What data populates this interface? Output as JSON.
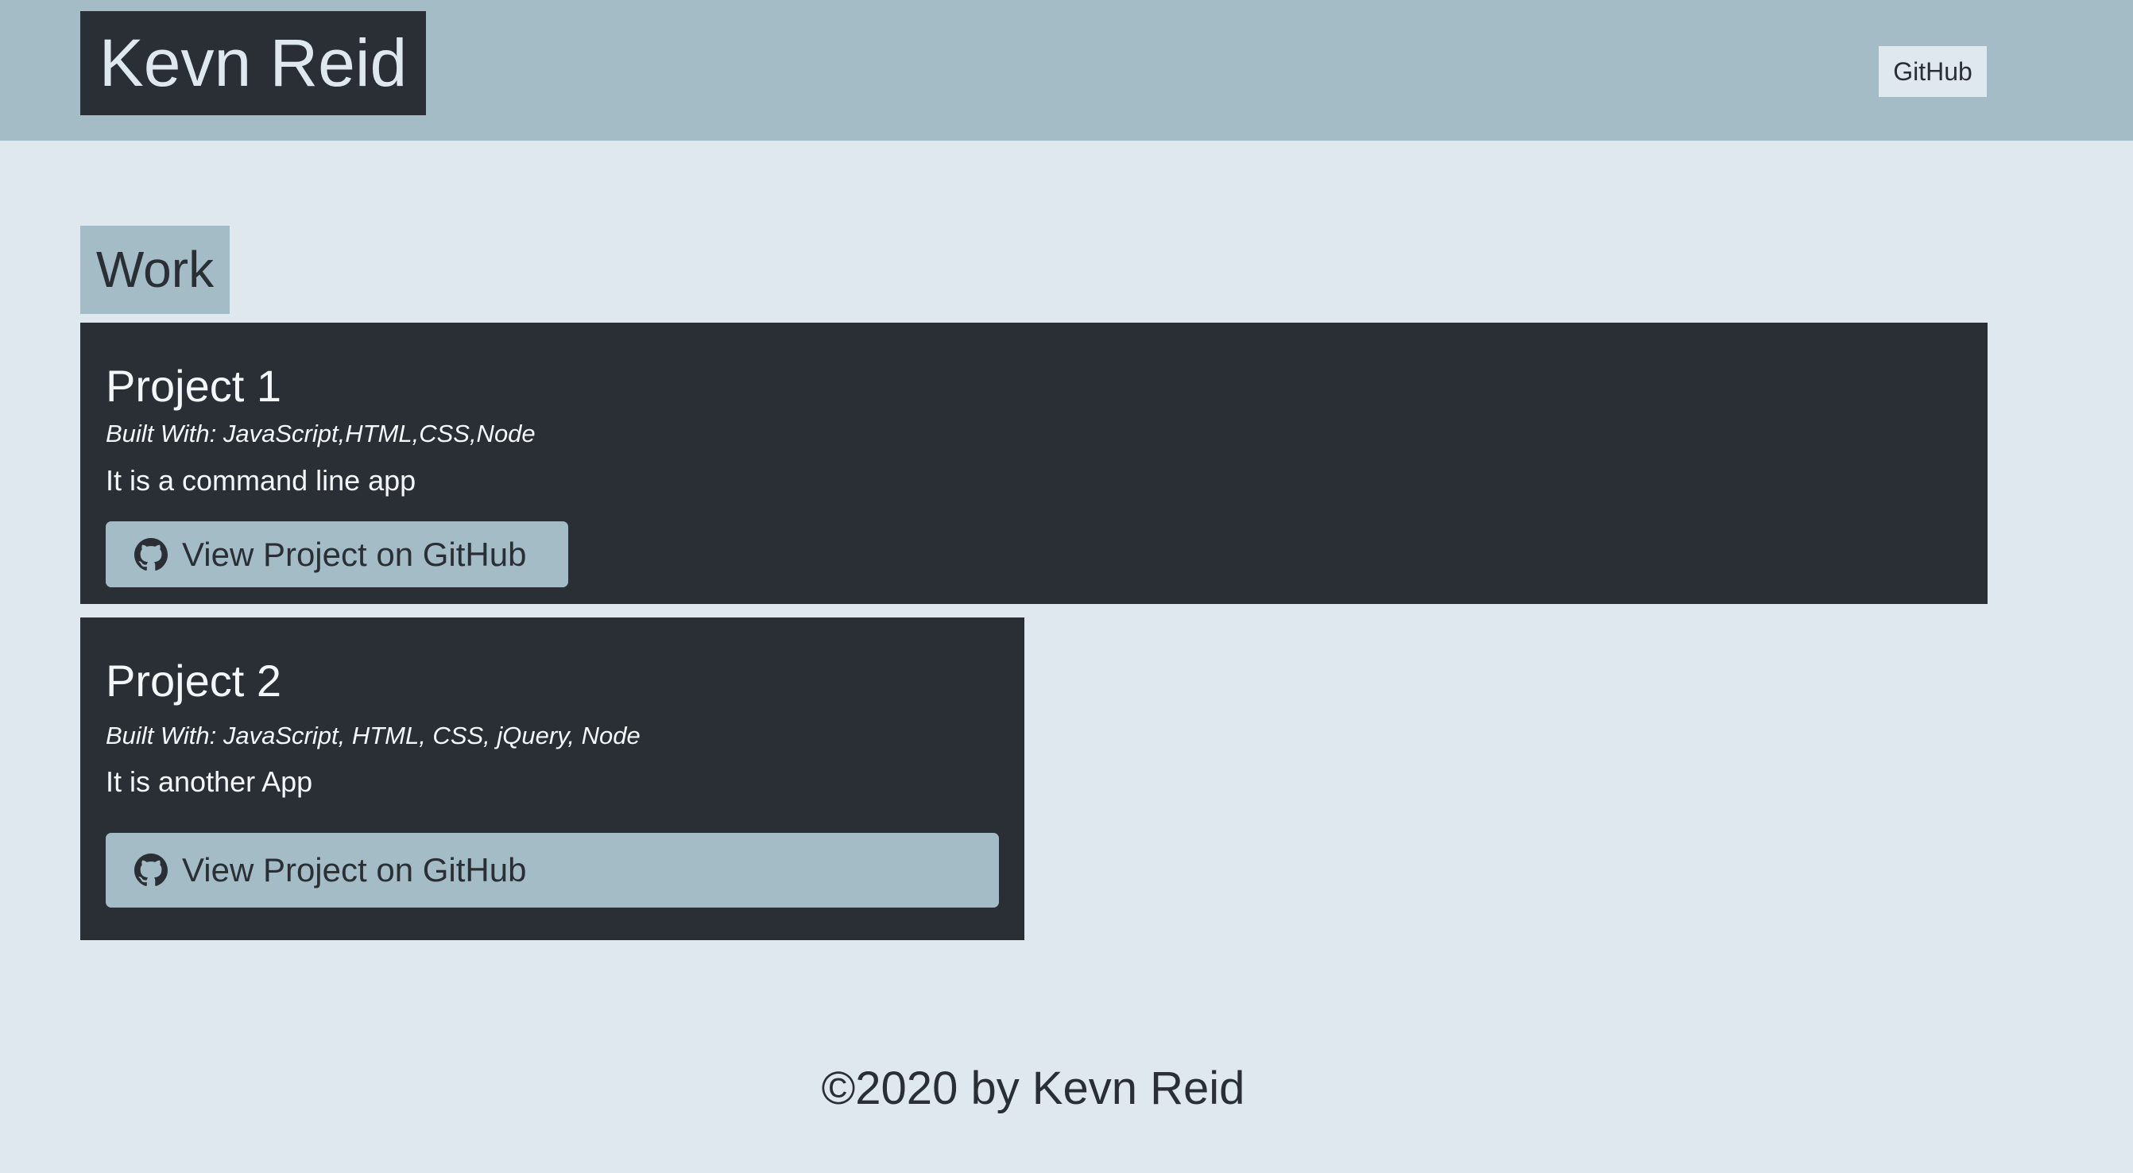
{
  "header": {
    "brand": "Kevn Reid",
    "nav_github": "GitHub"
  },
  "main": {
    "section_title": "Work",
    "projects": [
      {
        "title": "Project 1",
        "built_with": "Built With: JavaScript,HTML,CSS,Node",
        "description": "It is a command line app",
        "button_label": "View Project on GitHub",
        "button_icon": "github-icon"
      },
      {
        "title": "Project 2",
        "built_with": "Built With: JavaScript, HTML, CSS, jQuery, Node",
        "description": "It is another App",
        "button_label": "View Project on GitHub",
        "button_icon": "github-icon"
      }
    ]
  },
  "footer": {
    "text": "©2020 by Kevn Reid"
  },
  "colors": {
    "background": "#dee8ee",
    "header": "#a3bcc6",
    "dark": "#2a2f35",
    "accent": "#a3bcc6"
  }
}
